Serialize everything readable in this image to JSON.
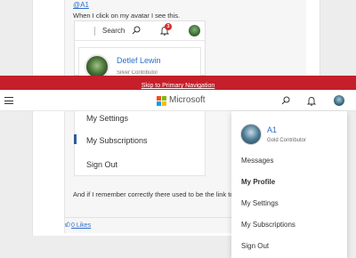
{
  "post": {
    "mention": "@A1",
    "text1": "When I click on my avatar I see this.",
    "text2": "And if I remember correctly there used to be the link to th",
    "likes": "0 Likes"
  },
  "embedded": {
    "search_label": "Search",
    "notification_count": "3",
    "profile_name": "Detlef Lewin",
    "profile_rank": "Silver Contributor",
    "menu_items": [
      "My Settings",
      "My Subscriptions",
      "Sign Out"
    ]
  },
  "skip_nav": {
    "label": "Skip to Primary Navigation"
  },
  "header": {
    "brand": "Microsoft",
    "logo_colors": [
      "#f25022",
      "#7fba00",
      "#00a4ef",
      "#ffb900"
    ]
  },
  "dropdown": {
    "user_name": "A1",
    "user_rank": "Gold Contributor",
    "items": [
      "Messages",
      "My Profile",
      "My Settings",
      "My Subscriptions",
      "Sign Out"
    ]
  },
  "colors": {
    "accent_red": "#c41f2a",
    "link_blue": "#2f6fc7"
  }
}
